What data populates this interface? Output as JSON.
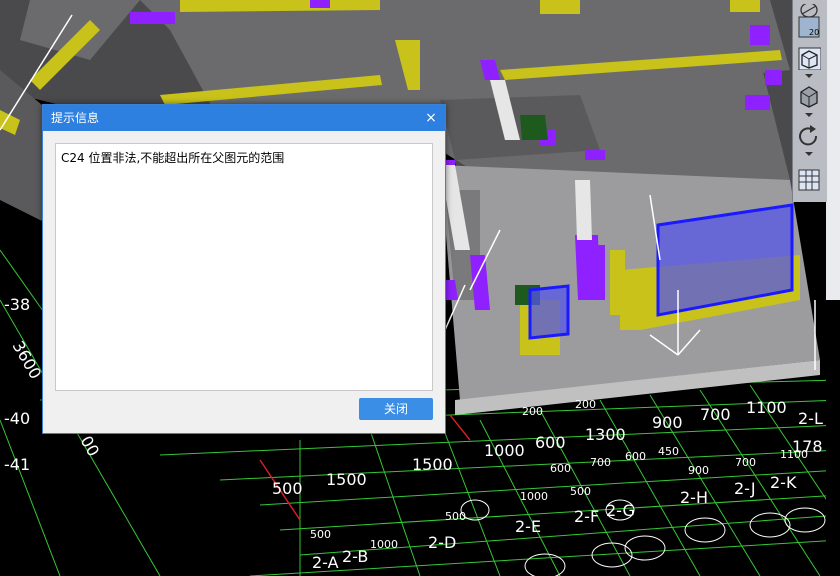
{
  "dialog": {
    "title": "提示信息",
    "close_glyph": "×",
    "message": "C24 位置非法,不能超出所在父图元的范围",
    "close_button": "关闭"
  },
  "toolbar": {
    "buttons": [
      {
        "icon": "sphere-view-icon"
      },
      {
        "icon": "scale-20-icon",
        "label": "20"
      },
      {
        "icon": "3d-box-wire-icon"
      },
      {
        "icon": "3d-box-solid-icon"
      },
      {
        "icon": "rotate-icon"
      },
      {
        "icon": "grid-table-icon"
      }
    ]
  },
  "drawing_labels": {
    "left_axis": [
      "-38",
      "3600",
      "-40",
      "-41",
      "00"
    ],
    "row_dims_1": [
      "500",
      "1500",
      "1500",
      "1000",
      "600",
      "1300",
      "900",
      "700",
      "1100",
      "2-L"
    ],
    "row_dims_2": [
      "178"
    ],
    "small_dims": [
      "200",
      "200",
      "600",
      "700",
      "600",
      "450",
      "900",
      "700",
      "1100",
      "1000",
      "500",
      "500",
      "1000",
      "500"
    ],
    "axis_labels": [
      "2-A",
      "2-B",
      "2-D",
      "2-E",
      "2-F",
      "2-G",
      "2-H",
      "2-J",
      "2-K"
    ]
  },
  "colors": {
    "background": "#000000",
    "slab": "#6b6b6d",
    "slab_light": "#9c9c9e",
    "beam_yellow": "#c8c21a",
    "column_purple": "#8f20ff",
    "opening_blue": "#3a3ae0",
    "grid_green": "#35c835",
    "grid_red": "#d02020",
    "dialog_title": "#2d7fe0",
    "dialog_button": "#3a8ee6"
  }
}
